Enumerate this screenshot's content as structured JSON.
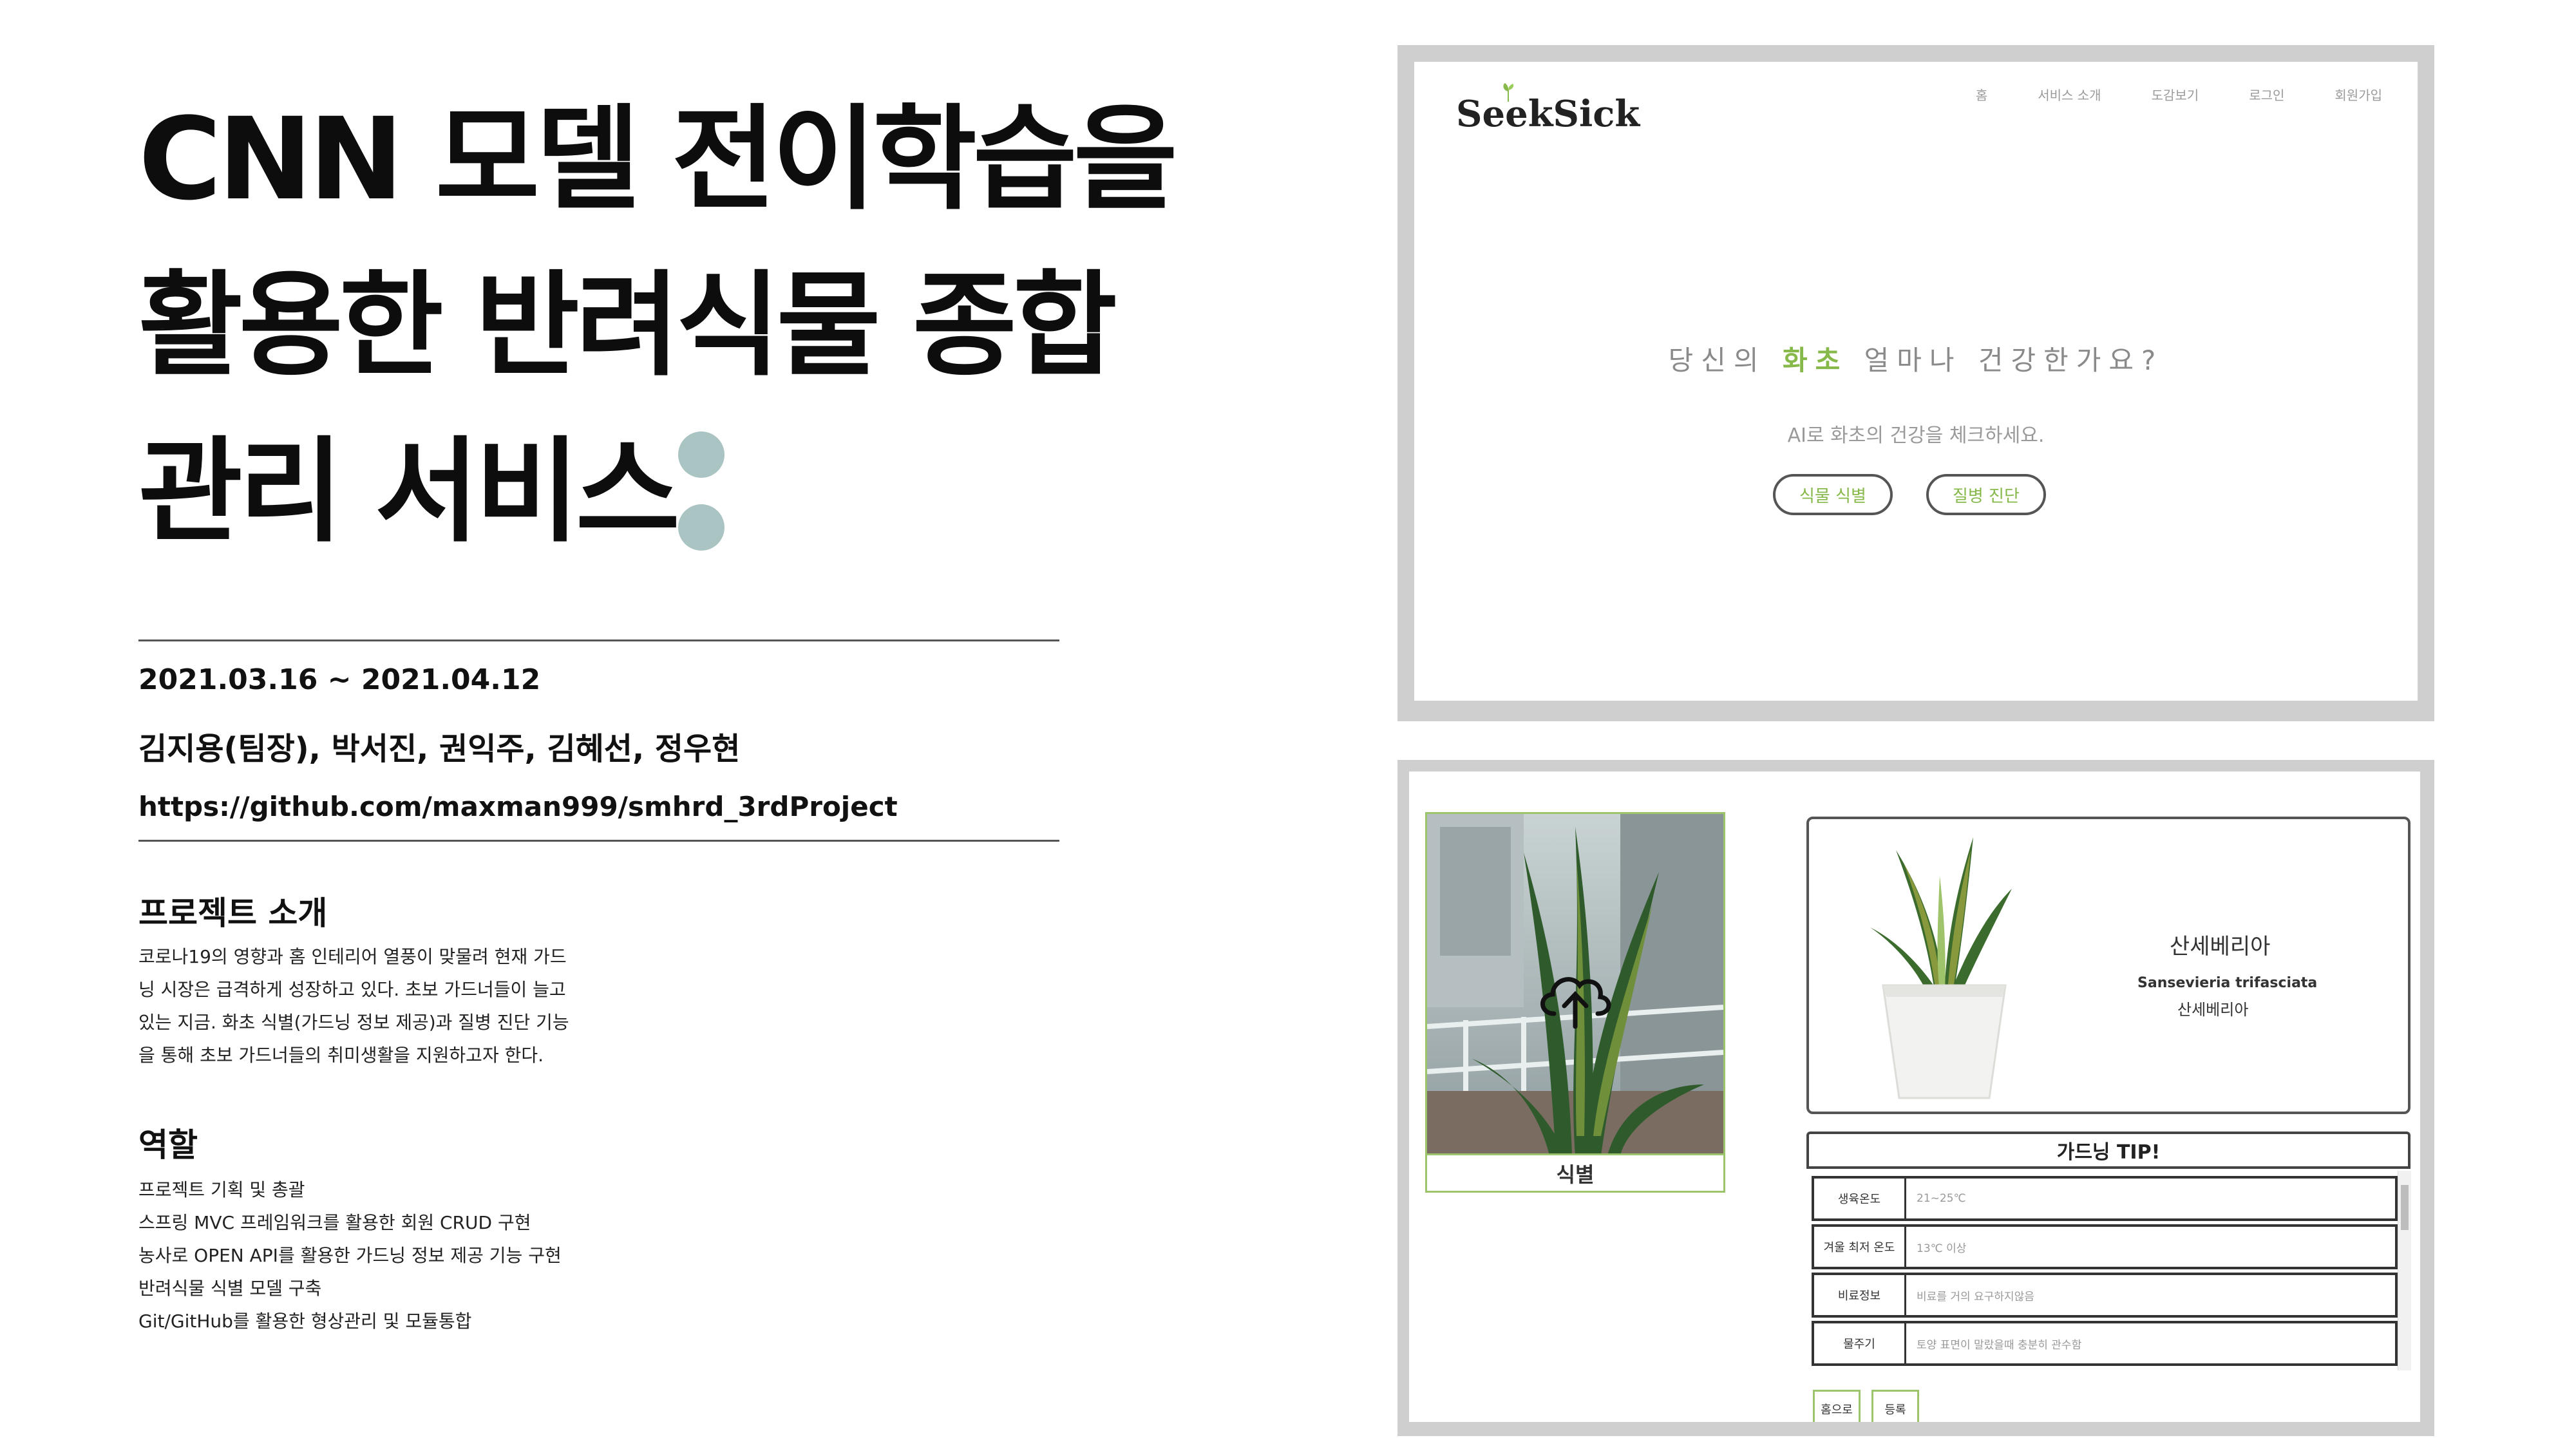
{
  "title": {
    "line1": "CNN 모델 전이학습을",
    "line2": "활용한 반려식물 종합",
    "line3": "관리 서비스"
  },
  "meta": {
    "dates": "2021.03.16 ~ 2021.04.12",
    "members": "김지용(팀장), 박서진, 권익주, 김혜선, 정우현",
    "github": "https://github.com/maxman999/smhrd_3rdProject"
  },
  "intro": {
    "heading": "프로젝트 소개",
    "lines": [
      "코로나19의 영향과 홈 인테리어 열풍이 맞물려 현재 가드",
      "닝 시장은 급격하게 성장하고 있다. 초보 가드너들이 늘고",
      "있는 지금. 화초 식별(가드닝 정보 제공)과 질병 진단 기능",
      "을 통해 초보 가드너들의 취미생활을 지원하고자 한다."
    ]
  },
  "roles": {
    "heading": "역할",
    "lines": [
      "프로젝트 기획 및 총괄",
      "스프링 MVC 프레임워크를 활용한 회원 CRUD 구현",
      "농사로 OPEN API를 활용한 가드닝 정보 제공 기능 구현",
      "반려식물 식별 모델 구축",
      "Git/GitHub를 활용한 형상관리 및 모듈통합"
    ]
  },
  "screen1": {
    "logo": "SeekSick",
    "nav": [
      "홈",
      "서비스 소개",
      "도감보기",
      "로그인",
      "회원가입"
    ],
    "hero_pre": "당신의 ",
    "hero_accent": "화초",
    "hero_post": " 얼마나 건강한가요?",
    "subtitle": "AI로 화초의 건강을 체크하세요.",
    "btn_identify": "식물 식별",
    "btn_diagnose": "질병 진단",
    "accent_color": "#86b84a"
  },
  "screen2": {
    "photo_label": "식별",
    "plant_name": "산세베리아",
    "scientific_name": "Sansevieria trifasciata",
    "plant_name_ko": "산세베리아",
    "tip_title": "가드닝 TIP!",
    "tips": [
      {
        "key": "생육온도",
        "value": "21~25℃"
      },
      {
        "key": "겨울 최저 온도",
        "value": "13℃ 이상"
      },
      {
        "key": "비료정보",
        "value": "비료를 거의 요구하지않음"
      },
      {
        "key": "물주기",
        "value": "토양 표면이 말랐을때 충분히 관수함"
      }
    ],
    "btn_home": "홈으로",
    "btn_register": "등록"
  }
}
